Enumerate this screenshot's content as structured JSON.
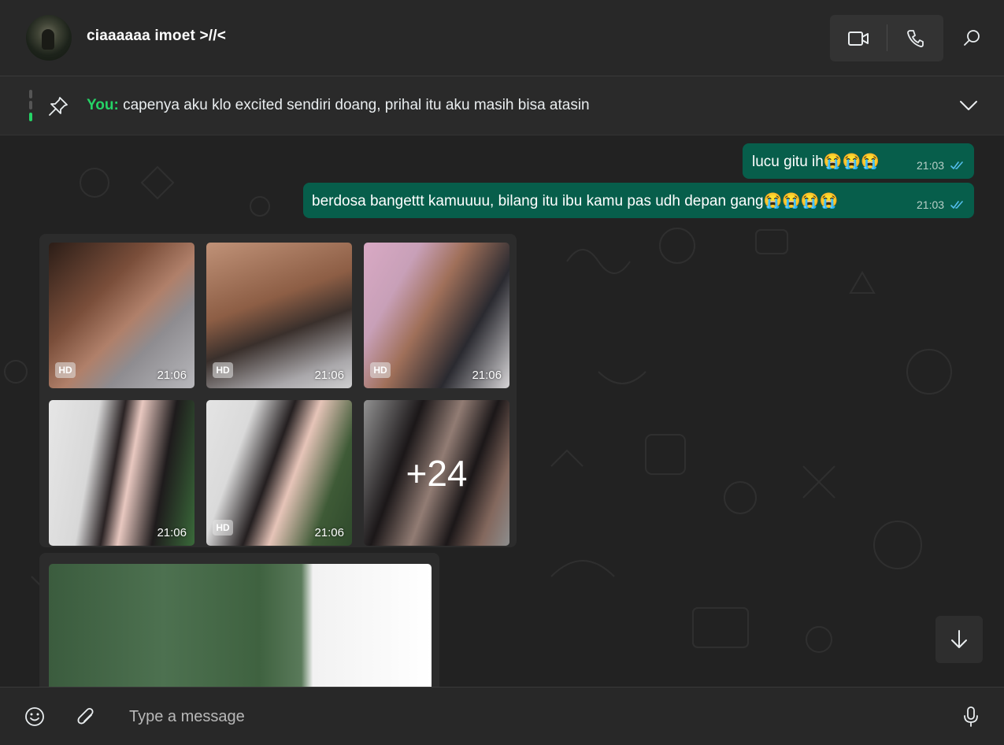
{
  "header": {
    "contact_name": "ciaaaaaa imoet >//<",
    "icons": [
      "video-call-icon",
      "voice-call-icon",
      "search-icon"
    ]
  },
  "pinned": {
    "sender": "You:",
    "text": "capenya aku klo excited sendiri doang, prihal itu aku masih bisa atasin"
  },
  "messages": [
    {
      "text": "lucu gitu ih😭😭😭",
      "time": "21:03",
      "status": "read"
    },
    {
      "text": "berdosa bangettt kamuuuu, bilang itu ibu kamu pas udh depan gang😭😭😭😭",
      "time": "21:03",
      "status": "read"
    }
  ],
  "media_album": {
    "items": [
      {
        "hd": "HD",
        "time": "21:06"
      },
      {
        "hd": "HD",
        "time": "21:06"
      },
      {
        "hd": "HD",
        "time": "21:06"
      },
      {
        "hd": "",
        "time": "21:06"
      },
      {
        "hd": "HD",
        "time": "21:06"
      },
      {
        "hd": "",
        "time": "",
        "overlay": "+24"
      }
    ]
  },
  "composer": {
    "placeholder": "Type a message"
  },
  "colors": {
    "accent": "#25d366",
    "outgoing_bubble": "#075e4b",
    "read_ticks": "#53bdeb"
  }
}
